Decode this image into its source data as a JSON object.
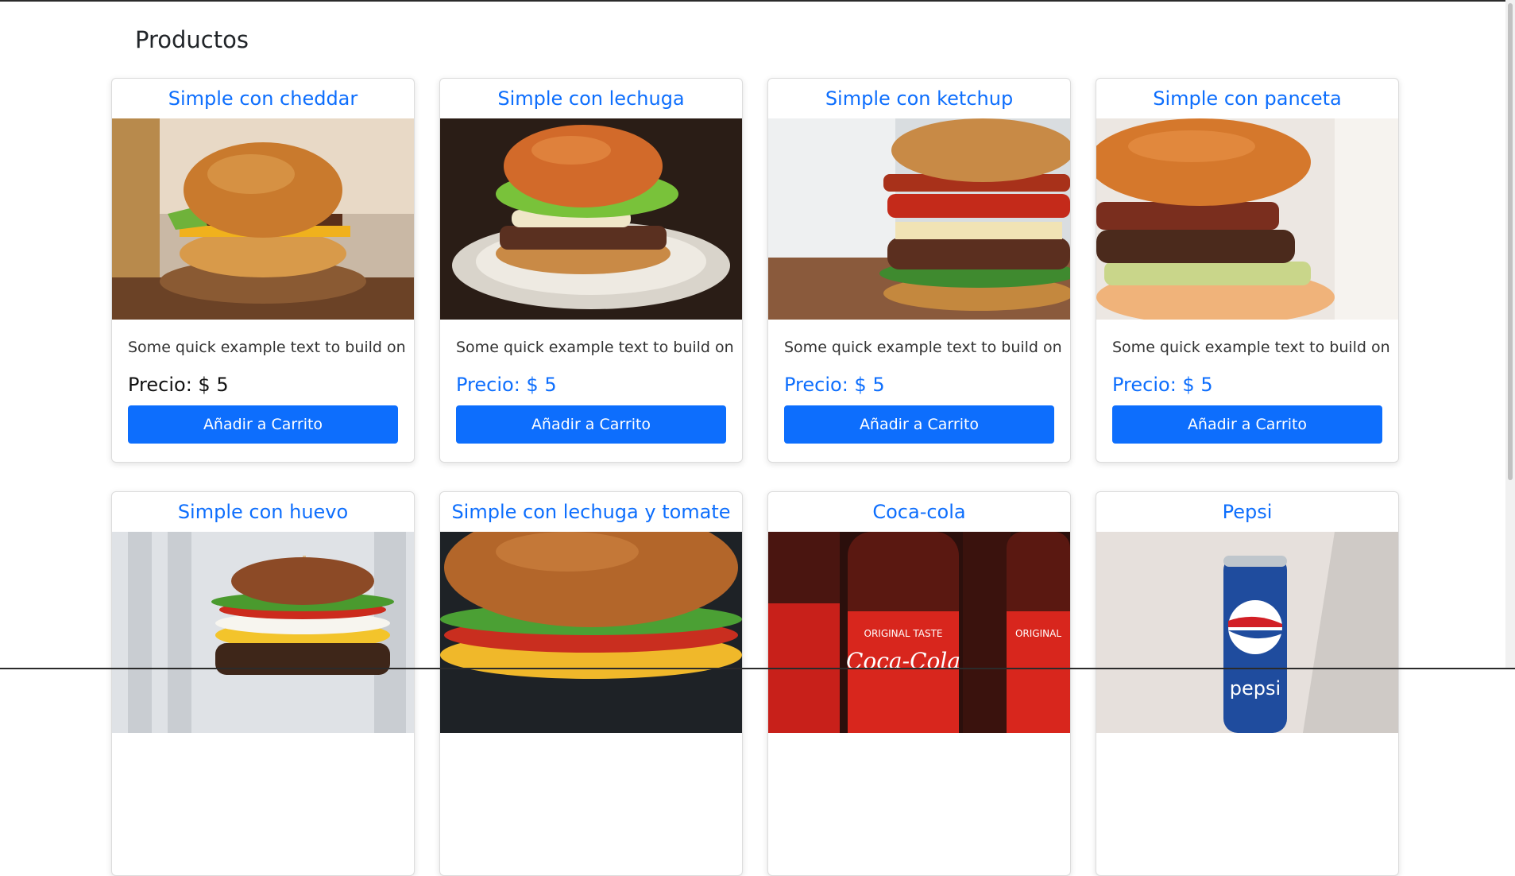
{
  "page": {
    "title": "Productos"
  },
  "products": [
    {
      "name": "Simple con cheddar",
      "description": "Some quick example text to build on",
      "price": "Precio: $ 5",
      "button": "Añadir a Carrito",
      "image": "burger-cheddar-photo"
    },
    {
      "name": "Simple con lechuga",
      "description": "Some quick example text to build on",
      "price": "Precio: $ 5",
      "button": "Añadir a Carrito",
      "image": "burger-lettuce-photo"
    },
    {
      "name": "Simple con ketchup",
      "description": "Some quick example text to build on",
      "price": "Precio: $ 5",
      "button": "Añadir a Carrito",
      "image": "burger-ketchup-photo"
    },
    {
      "name": "Simple con panceta",
      "description": "Some quick example text to build on",
      "price": "Precio: $ 5",
      "button": "Añadir a Carrito",
      "image": "burger-bacon-photo"
    },
    {
      "name": "Simple con huevo",
      "image": "burger-egg-photo"
    },
    {
      "name": "Simple con lechuga y tomate",
      "image": "burger-lettuce-tomato-photo"
    },
    {
      "name": "Coca-cola",
      "image": "coca-cola-bottles-photo",
      "image_text": [
        "ORIGINAL TASTE",
        "Coca-Cola",
        "ORIGINAL"
      ]
    },
    {
      "name": "Pepsi",
      "image": "pepsi-can-photo",
      "image_text": [
        "pepsi"
      ]
    }
  ]
}
